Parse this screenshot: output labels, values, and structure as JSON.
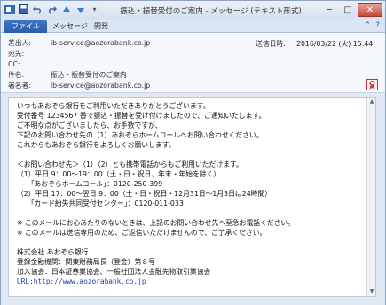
{
  "window": {
    "title": "振込・振替受付のご案内 - メッセージ (テキスト形式)",
    "controls": {
      "minimize": "─",
      "maximize": "□",
      "close": "✕"
    }
  },
  "ribbon": {
    "tabs": [
      {
        "label": "ファイル"
      },
      {
        "label": "メッセージ"
      },
      {
        "label": "開発"
      }
    ]
  },
  "header": {
    "from_label": "差出人:",
    "from_value": "ib-service@aozorabank.co.jp",
    "to_label": "宛先:",
    "to_value": "",
    "cc_label": "CC:",
    "cc_value": "",
    "subject_label": "件名:",
    "subject_value": "振込・振替受付のご案内",
    "signer_label": "署名者:",
    "signer_value": "ib-service@aozorabank.co.jp",
    "sent_label": "送信日時:",
    "sent_value": "2016/03/22 (火) 15:44"
  },
  "body": {
    "lines": [
      "いつもあおぞら銀行をご利用いただきありがとうございます。",
      "受付番号 1234567 番で振込・振替を受け付けましたので、ご通知いたします。",
      "ご不明な点がございましたら、お手数ですが、",
      "下記のお問い合わせ先の（1）あおぞらホームコールへお問い合わせください。",
      "これからもあおぞら銀行をよろしくお願いします。",
      "",
      "＜お問い合わせ先＞（1）（2）とも携帯電話からもご利用いただけます。",
      "（1）平日 9：00～19：00（土・日・祝日、年末・年始を除く）",
      "　　「あおぞらホームコール」：0120-250-399",
      "（2）平日 17：00～翌日 9：00（土・日・祝日・12月31日～1月3日は24時間）",
      "　　「カード紛失共同受付センター」：0120-011-033",
      "",
      "※ このメールにお心あたりのないときは、上記のお問い合わせ先へ至急お電話ください。",
      "※ このメールは送信専用のため、ご返信いただけませんので、ご了承ください。",
      "",
      "株式会社 あおぞら銀行",
      "登録金融機関：関東財務局長（登金）第８号",
      "加入協会：日本証券業協会、一般社団法人金融先物取引業協会"
    ],
    "url_line": "URL:http://www.aozorabank.co.jp"
  }
}
